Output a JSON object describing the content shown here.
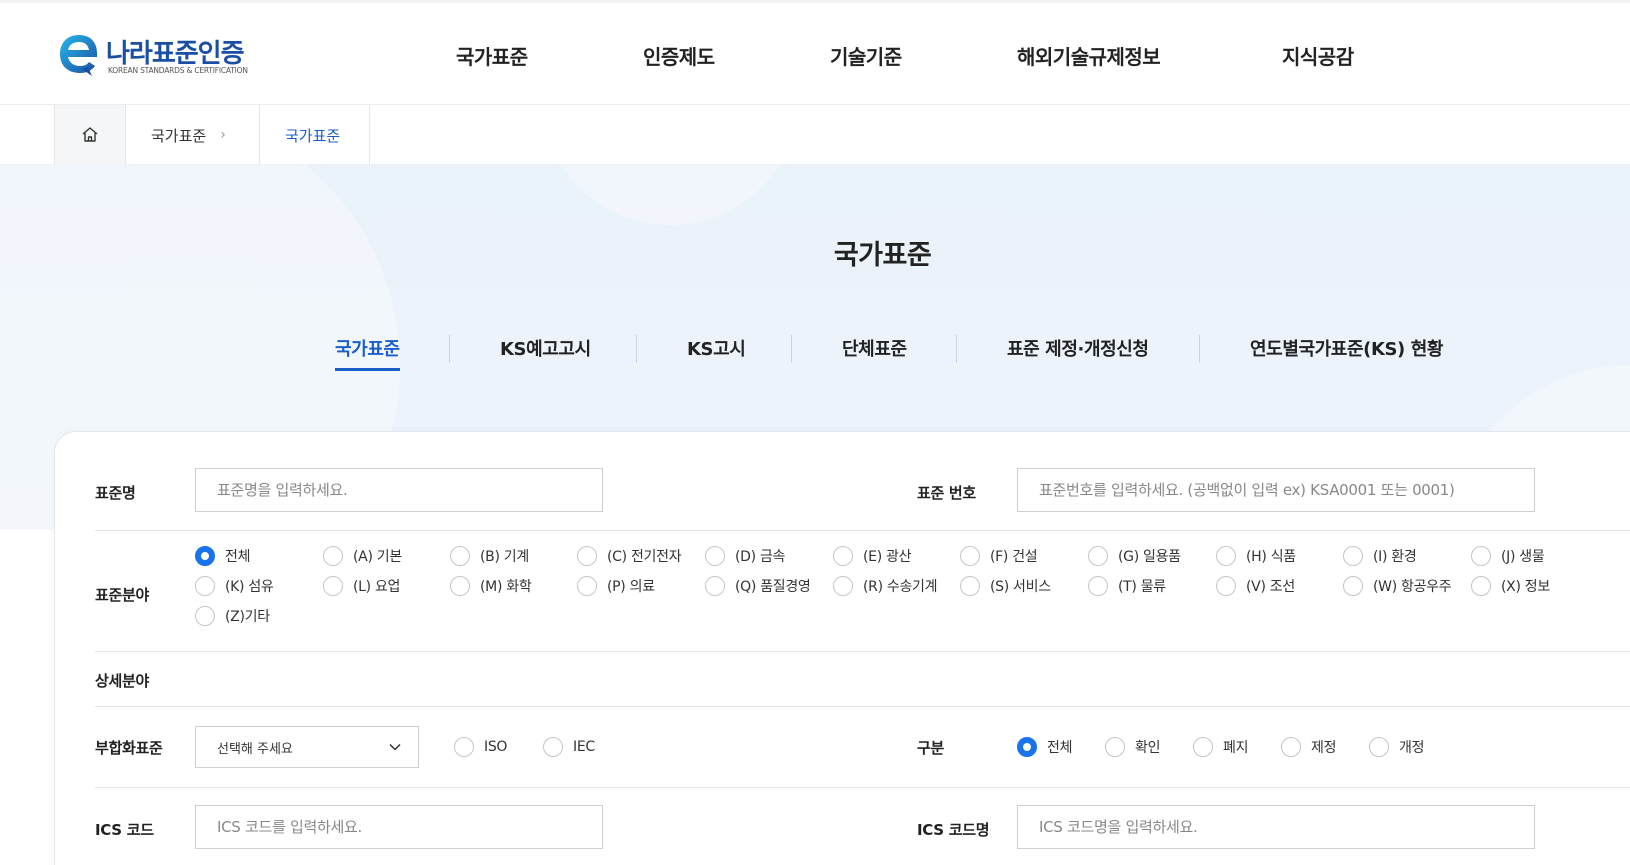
{
  "header": {
    "logo_title": "나라표준인증",
    "logo_sub": "KOREAN STANDARDS & CERTIFICATION",
    "nav": [
      "국가표준",
      "인증제도",
      "기술기준",
      "해외기술규제정보",
      "지식공감"
    ]
  },
  "breadcrumb": {
    "home_icon": "home-icon",
    "items": [
      "국가표준",
      "국가표준"
    ]
  },
  "hero": {
    "title": "국가표준",
    "tabs": [
      "국가표준",
      "KS예고고시",
      "KS고시",
      "단체표준",
      "표준 제정·개정신청",
      "연도별국가표준(KS) 현황"
    ],
    "active_tab": 0
  },
  "search": {
    "std_name_label": "표준명",
    "std_name_placeholder": "표준명을 입력하세요.",
    "std_no_label": "표준 번호",
    "std_no_placeholder": "표준번호를 입력하세요. (공백없이 입력 ex) KSA0001 또는 0001)",
    "field_label": "표준분야",
    "fields": [
      "전체",
      "(A) 기본",
      "(B) 기계",
      "(C) 전기전자",
      "(D) 금속",
      "(E) 광산",
      "(F) 건설",
      "(G) 일용품",
      "(H) 식품",
      "(I) 환경",
      "(J) 생물",
      "(K) 섬유",
      "(L) 요업",
      "(M) 화학",
      "(P) 의료",
      "(Q) 품질경영",
      "(R) 수송기계",
      "(S) 서비스",
      "(T) 물류",
      "(V) 조선",
      "(W) 항공우주",
      "(X) 정보",
      "(Z)기타"
    ],
    "field_selected": "전체",
    "detail_label": "상세분야",
    "harmonized_label": "부합화표준",
    "harmonized_select": "선택해 주세요",
    "harmonized_options": [
      "ISO",
      "IEC"
    ],
    "type_label": "구분",
    "types": [
      "전체",
      "확인",
      "폐지",
      "제정",
      "개정"
    ],
    "type_selected": "전체",
    "ics_code_label": "ICS 코드",
    "ics_code_placeholder": "ICS 코드를 입력하세요.",
    "ics_name_label": "ICS 코드명",
    "ics_name_placeholder": "ICS 코드명을 입력하세요."
  },
  "colors": {
    "accent": "#1a5fc9",
    "radio": "#1a73e8",
    "hero_bg": "#eaf2fa"
  }
}
